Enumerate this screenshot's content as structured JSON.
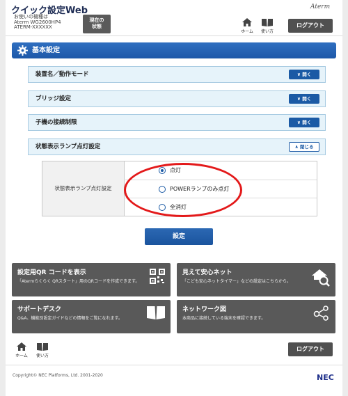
{
  "header": {
    "title": "クイック設定Web",
    "model_lines": [
      "お使いの機種は",
      "Aterm WG2600HP4",
      "ATERM-XXXXXX"
    ],
    "current_state_button": [
      "現在の",
      "状態"
    ],
    "logo": "Aterm",
    "home_label": "ホーム",
    "help_label": "使い方",
    "logout_label": "ログアウト"
  },
  "section": {
    "title": "基本設定"
  },
  "accordions": [
    {
      "label": "装置名／動作モード",
      "button": "開く",
      "state": "collapsed"
    },
    {
      "label": "ブリッジ設定",
      "button": "開く",
      "state": "collapsed"
    },
    {
      "label": "子機の接続制限",
      "button": "開く",
      "state": "collapsed"
    },
    {
      "label": "状態表示ランプ点灯設定",
      "button": "閉じる",
      "state": "expanded"
    }
  ],
  "lamp_setting": {
    "label": "状態表示ランプ点灯設定",
    "options": [
      {
        "label": "点灯",
        "selected": true
      },
      {
        "label": "POWERランプのみ点灯",
        "selected": false
      },
      {
        "label": "全消灯",
        "selected": false
      }
    ],
    "annotation_color": "#e3191a"
  },
  "submit_label": "設定",
  "tiles": [
    {
      "title": "設定用QR コードを表示",
      "desc": "「Atermらくらく QRスタート」用のQRコードを作成できます。",
      "icon": "qr-code-icon"
    },
    {
      "title": "見えて安心ネット",
      "desc": "「こども安心ネットタイマー」などの設定はこちらから。",
      "icon": "home-search-icon"
    },
    {
      "title": "サポートデスク",
      "desc": "Q&A、機能別設定ガイドなどの情報をご覧になれます。",
      "icon": "book-icon"
    },
    {
      "title": "ネットワーク図",
      "desc": "本商品に接続している端末を確認できます。",
      "icon": "network-icon"
    }
  ],
  "footer": {
    "home_label": "ホーム",
    "help_label": "使い方",
    "logout_label": "ログアウト",
    "copyright": "Copyright© NEC Platforms, Ltd. 2001-2020",
    "brand": "NEC"
  },
  "colors": {
    "primary": "#1b5aa5",
    "accordion_bg": "#e6f3fa",
    "tile_bg": "#595959"
  }
}
